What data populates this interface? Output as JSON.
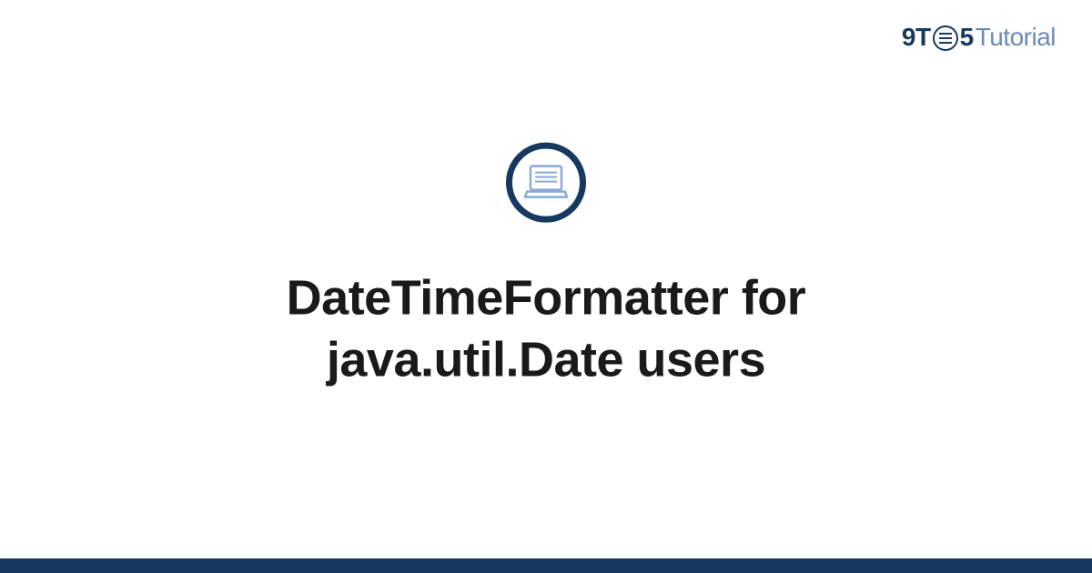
{
  "logo": {
    "part1": "9T",
    "part2": "5",
    "part3": "Tutorial"
  },
  "icon": {
    "name": "laptop-document-icon"
  },
  "title": "DateTimeFormatter for java.util.Date users",
  "colors": {
    "primary": "#17395f",
    "secondary": "#6a8bb5",
    "iconStroke": "#8aa9d6"
  }
}
